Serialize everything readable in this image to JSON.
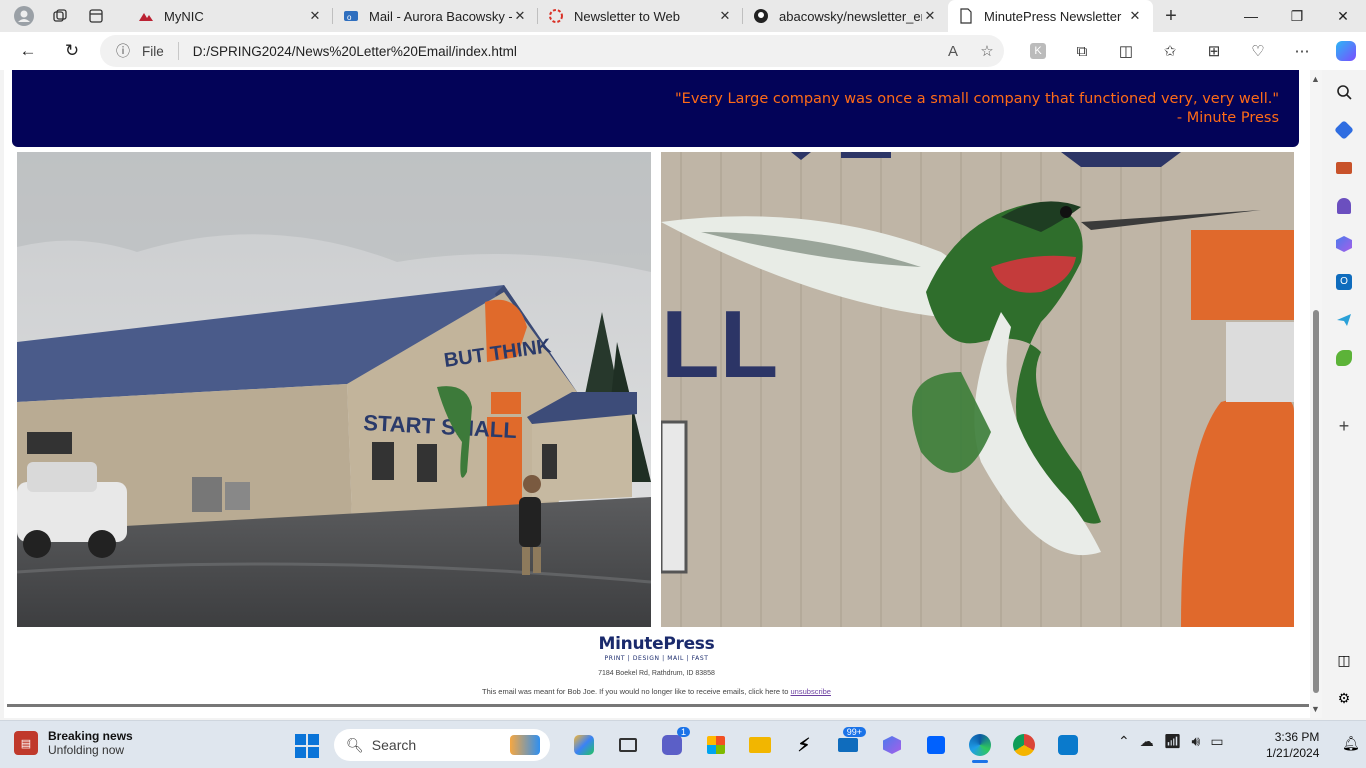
{
  "tabs": [
    {
      "title": "MyNIC",
      "active": false
    },
    {
      "title": "Mail - Aurora Bacowsky - C",
      "active": false
    },
    {
      "title": "Newsletter to Web",
      "active": false
    },
    {
      "title": "abacowsky/newsletter_em",
      "active": false
    },
    {
      "title": "MinutePress Newsletter",
      "active": true
    }
  ],
  "address_bar": {
    "scheme_label": "File",
    "url": "D:/SPRING2024/News%20Letter%20Email/index.html"
  },
  "page": {
    "quote_line1": "\"Every Large company was once a small company that functioned very, very well.\"",
    "quote_line2": "- Minute Press",
    "photo1_sign_top": "BUT THINK",
    "photo1_sign_bottom": "START SMALL",
    "photo2_letters": "LL",
    "logo_main": "MinutePress",
    "logo_sub": "PRINT | DESIGN | MAIL | FAST",
    "address": "7184 Boekel Rd, Rathdrum, ID 83858",
    "unsubscribe_text": "This email was meant for Bob Joe. If you would no longer like to receive emails, click here to",
    "unsubscribe_link": "unsubscribe"
  },
  "taskbar": {
    "news_title": "Breaking news",
    "news_sub": "Unfolding now",
    "search_placeholder": "Search",
    "teams_badge": "1",
    "mail_badge": "99+",
    "time": "3:36 PM",
    "date": "1/21/2024"
  },
  "colors": {
    "banner_bg": "#030358",
    "quote_text": "#ff6b17",
    "logo": "#1a2a6c"
  }
}
